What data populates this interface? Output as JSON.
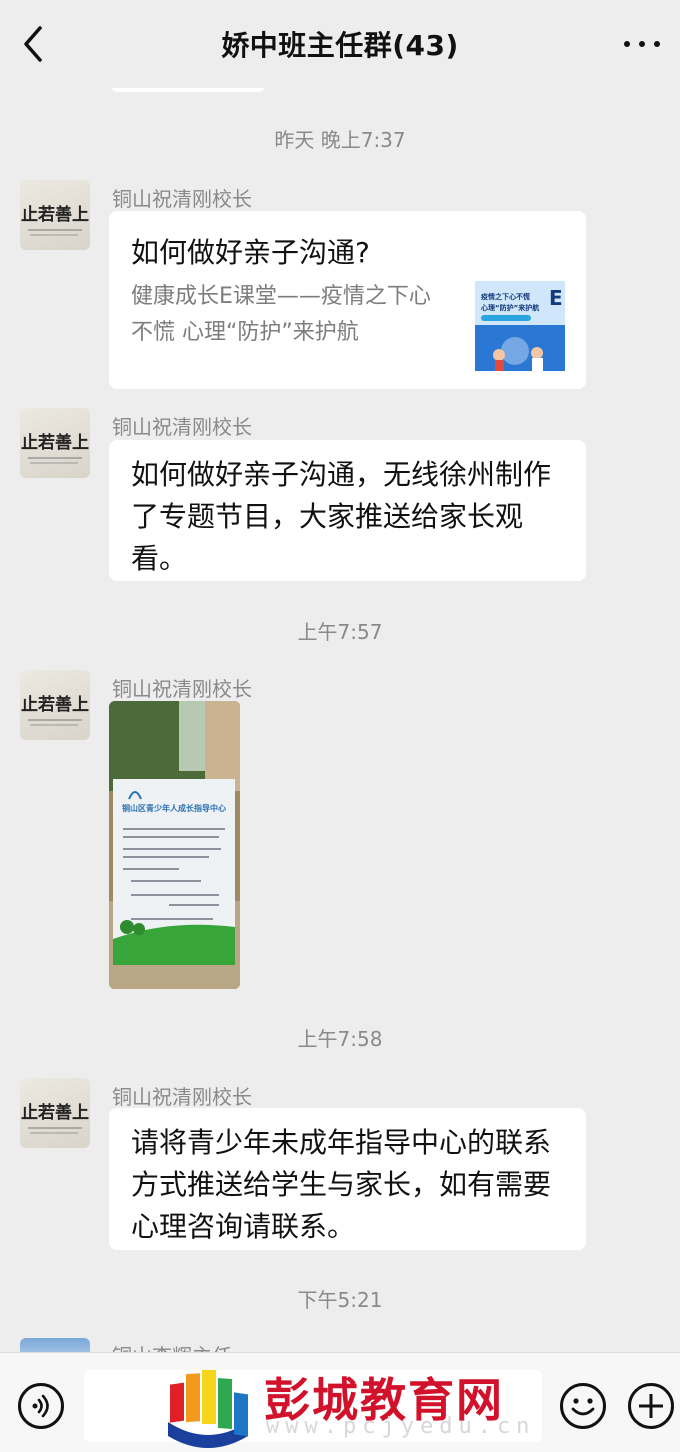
{
  "header": {
    "title": "娇中班主任群(43)"
  },
  "messages": {
    "time1": "昨天 晚上7:37",
    "msg1": {
      "sender": "铜山祝清刚校长",
      "card_title": "如何做好亲子沟通?",
      "card_desc": "健康成长E课堂——疫情之下心不慌 心理“防护”来护航",
      "thumb_line1": "疫情之下心不慌",
      "thumb_line2": "心理“防护”来护航",
      "thumb_letter": "E"
    },
    "msg2": {
      "sender": "铜山祝清刚校长",
      "text": "如何做好亲子沟通，无线徐州制作了专题节目，大家推送给家长观看。"
    },
    "time2": "上午7:57",
    "msg3": {
      "sender": "铜山祝清刚校长",
      "poster_heading": "铜山区青少年人成长指导中心"
    },
    "time3": "上午7:58",
    "msg4": {
      "sender": "铜山祝清刚校长",
      "text": "请将青少年未成年指导中心的联系方式推送给学生与家长，如有需要心理咨询请联系。"
    },
    "time4": "下午5:21",
    "msg5": {
      "sender": "铜山李辉主任"
    }
  },
  "avatar": {
    "calligraphy": "止若善上"
  },
  "watermark": {
    "name": "彭城教育网",
    "url": "www.pcjyedu.cn"
  },
  "colors": {
    "background": "#ededed",
    "bubble": "#ffffff",
    "watermark_red": "#d2112a"
  }
}
